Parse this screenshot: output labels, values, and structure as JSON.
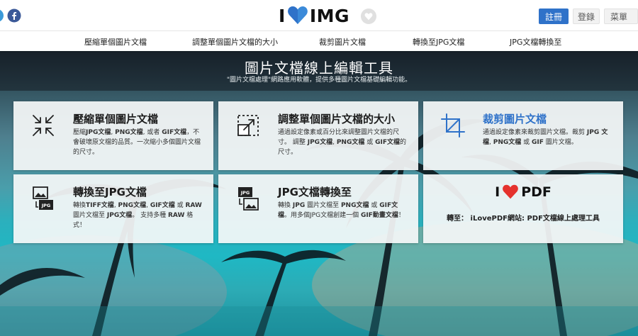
{
  "header": {
    "brand_left": "I",
    "brand_right": "IMG",
    "register_label": "註冊",
    "login_label": "登錄",
    "menu_label": "菜單",
    "social": [
      "twitter-icon",
      "facebook-icon"
    ]
  },
  "nav": {
    "items": [
      {
        "label": "壓縮單個圖片文檔"
      },
      {
        "label": "調整單個圖片文檔的大小"
      },
      {
        "label": "裁剪圖片文檔"
      },
      {
        "label": "轉換至JPG文檔"
      },
      {
        "label": "JPG文檔轉換至"
      }
    ]
  },
  "hero": {
    "title": "圖片文檔線上編輯工具",
    "subtitle": "\"圖片文檔處理\"網路應用軟體，提供多種圖片文檔基礎編輯功能。"
  },
  "tools": [
    {
      "title": "壓縮單個圖片文檔",
      "icon": "compress-icon",
      "desc_html": "壓縮<b>JPG文檔</b>, <b>PNG文檔</b>, 或者 <b>GIF文檔</b>，不會破壞原文檔的品質。一次縮小多個圖片文檔的尺寸。"
    },
    {
      "title": "調整單個圖片文檔的大小",
      "icon": "resize-icon",
      "desc_html": "通過設定像素或百分比來調整圖片文檔的尺寸。 調整 <b>JPG文檔</b>, <b>PNG文檔</b> 或 <b>GIF文檔</b>的尺寸。"
    },
    {
      "title": "裁剪圖片文檔",
      "icon": "crop-icon",
      "desc_html": "通過設定像素來裁剪圖片文檔。裁剪 <b>JPG 文檔</b>, <b>PNG文檔</b> 或 <b>GIF</b> 圖片文檔。"
    },
    {
      "title": "轉換至JPG文檔",
      "icon": "convert-to-jpg-icon",
      "desc_html": "轉換<b>TIFF文檔</b>, <b>PNG文檔</b>, <b>GIF文檔</b> 或 <b>RAW</b> 圖片文檔至 <b>JPG文檔</b>。 支持多種 <b>RAW</b> 格式！"
    },
    {
      "title": "JPG文檔轉換至",
      "icon": "convert-from-jpg-icon",
      "desc_html": "轉換 <b>JPG</b> 圖片文檔至 <b>PNG文檔</b> 或 <b>GIF文檔</b>。用多個JPG文檔創建一個 <b>GIF動畫文檔</b>！"
    }
  ],
  "promo": {
    "brand_left": "I",
    "brand_right": "PDF",
    "link_text": "轉至： iLovePDF網站: PDF文檔線上處理工具"
  },
  "colors": {
    "accent": "#2f72c9",
    "heart": "#e5322d"
  }
}
